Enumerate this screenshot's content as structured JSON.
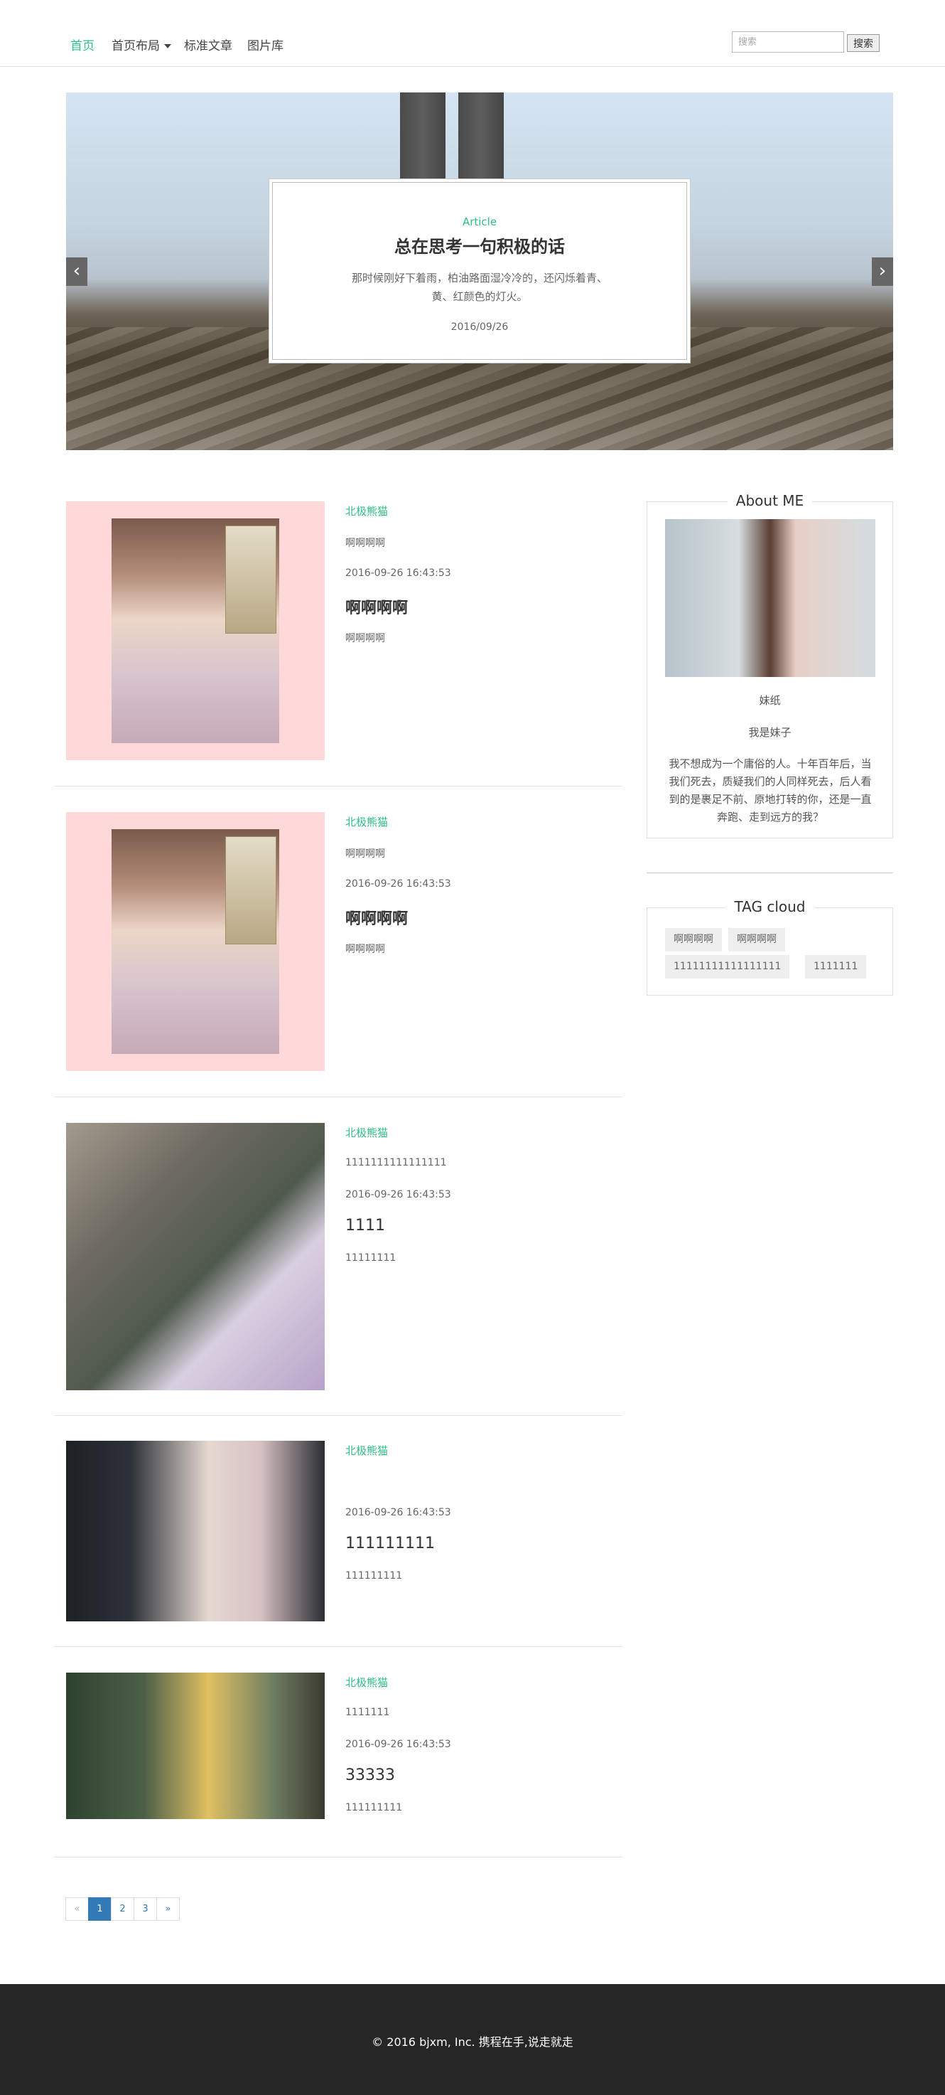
{
  "nav": {
    "items": [
      {
        "label": "首页"
      },
      {
        "label": "首页布局"
      },
      {
        "label": "标准文章"
      },
      {
        "label": "图片库"
      }
    ],
    "search_placeholder": "搜索",
    "search_button": "搜索"
  },
  "carousel": {
    "tag": "Article",
    "title": "总在思考一句积极的话",
    "text": "那时候刚好下着雨，柏油路面湿冷冷的，还闪烁着青、黄、红颜色的灯火。",
    "date": "2016/09/26",
    "prev_icon": "‹",
    "next_icon": "›"
  },
  "articles": [
    {
      "category": "北极熊猫",
      "subtitle": "啊啊啊啊",
      "date": "2016-09-26 16:43:53",
      "title": "啊啊啊啊",
      "desc": "啊啊啊啊"
    },
    {
      "category": "北极熊猫",
      "subtitle": "啊啊啊啊",
      "date": "2016-09-26 16:43:53",
      "title": "啊啊啊啊",
      "desc": "啊啊啊啊"
    },
    {
      "category": "北极熊猫",
      "subtitle": "1111111111111111",
      "date": "2016-09-26 16:43:53",
      "title": "1111",
      "desc": "11111111"
    },
    {
      "category": "北极熊猫",
      "subtitle": "",
      "date": "2016-09-26 16:43:53",
      "title": "111111111",
      "desc": "111111111"
    },
    {
      "category": "北极熊猫",
      "subtitle": "1111111",
      "date": "2016-09-26 16:43:53",
      "title": "33333",
      "desc": "111111111"
    }
  ],
  "pagination": {
    "prev": "«",
    "pages": [
      "1",
      "2",
      "3"
    ],
    "next": "»"
  },
  "about": {
    "title": "About ME",
    "name": "妹纸",
    "sub": "我是妹子",
    "text": "我不想成为一个庸俗的人。十年百年后，当我们死去，质疑我们的人同样死去，后人看到的是裹足不前、原地打转的你，还是一直奔跑、走到远方的我？"
  },
  "tags": {
    "title": "TAG cloud",
    "items": [
      "啊啊啊啊",
      "啊啊啊啊",
      "11111111111111111",
      "1111111"
    ]
  },
  "footer": {
    "text": "© 2016 bjxm, Inc. 携程在手,说走就走"
  }
}
